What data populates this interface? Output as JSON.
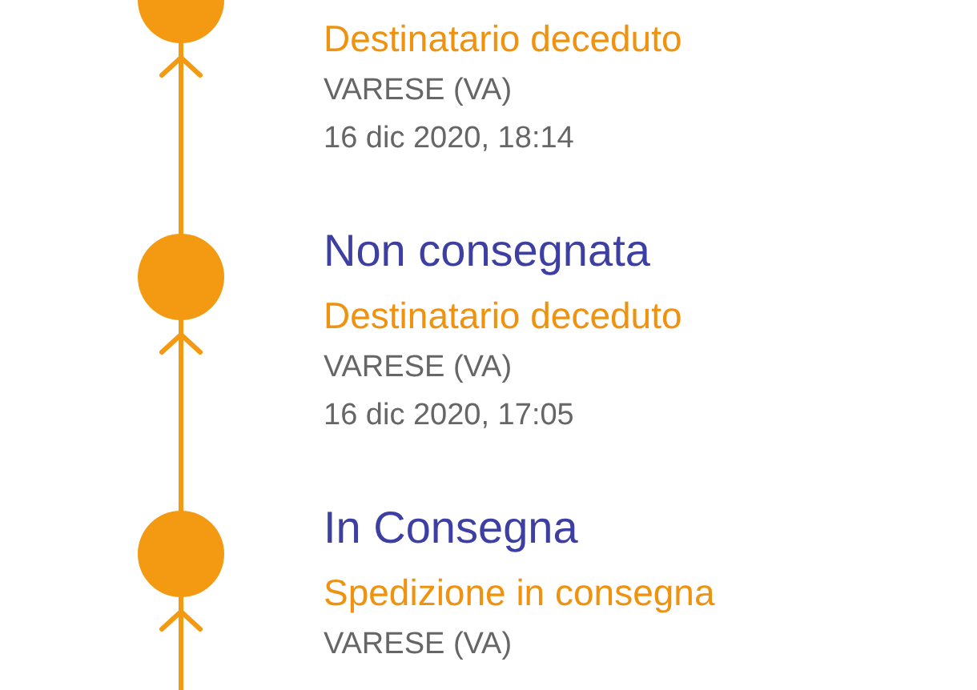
{
  "events": [
    {
      "status": "Destinatario deceduto",
      "place": "VARESE (VA)",
      "date": "16 dic 2020, 18:14"
    },
    {
      "title": "Non consegnata",
      "status": "Destinatario deceduto",
      "place": "VARESE (VA)",
      "date": "16 dic 2020, 17:05"
    },
    {
      "title": "In Consegna",
      "status": "Spedizione in consegna",
      "place": "VARESE (VA)"
    }
  ]
}
